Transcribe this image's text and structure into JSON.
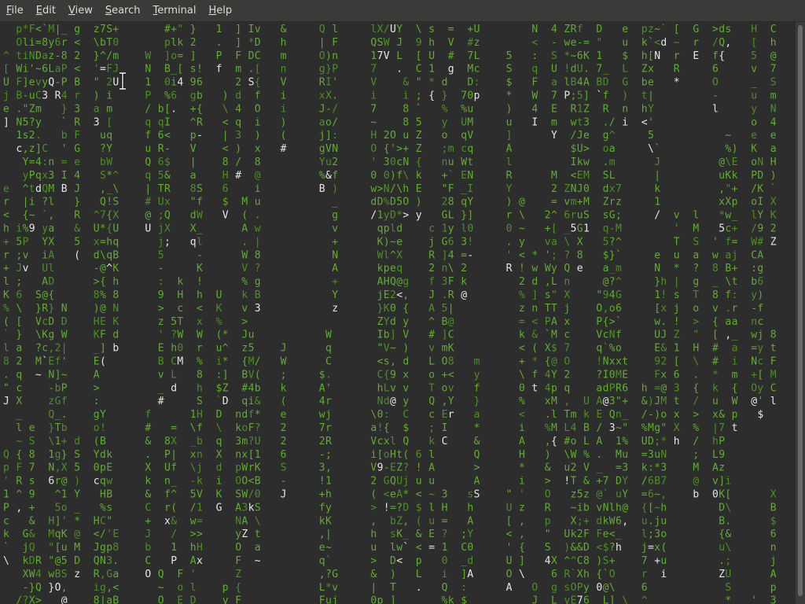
{
  "menu": [
    {
      "mnemonic": "F",
      "rest": "ile"
    },
    {
      "mnemonic": "E",
      "rest": "dit"
    },
    {
      "mnemonic": "V",
      "rest": "iew"
    },
    {
      "mnemonic": "S",
      "rest": "earch"
    },
    {
      "mnemonic": "T",
      "rest": "erminal"
    },
    {
      "mnemonic": "H",
      "rest": "elp"
    }
  ],
  "colors": {
    "rain": "#5fae2c",
    "rain_dim": "#4c8f22",
    "highlight": "#e6e6e6",
    "background": "#2d2d2d",
    "menubar": "#3a3a38"
  },
  "charset": "abcdefghijklmnopqrstuvwxyzABCDEFGHIJKLMNOPQRSTUVWXYZ0123456789!@#$%^&*()_+-=[]{};:'\",.<>/?\\|`~",
  "seed": 20240517
}
